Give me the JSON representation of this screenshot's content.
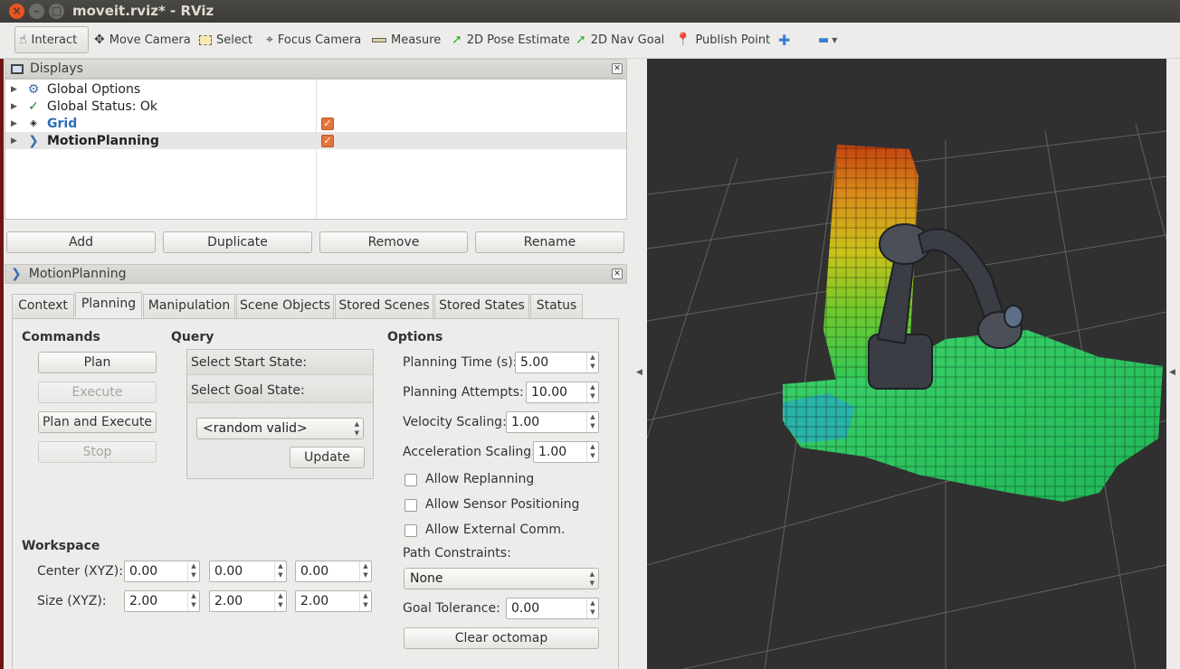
{
  "window": {
    "title": "moveit.rviz* - RViz"
  },
  "toolbar": {
    "items": [
      {
        "label": "Interact",
        "icon": "hand-icon"
      },
      {
        "label": "Move Camera",
        "icon": "move-camera-icon"
      },
      {
        "label": "Select",
        "icon": "select-icon"
      },
      {
        "label": "Focus Camera",
        "icon": "focus-camera-icon"
      },
      {
        "label": "Measure",
        "icon": "ruler-icon"
      },
      {
        "label": "2D Pose Estimate",
        "icon": "green-arrow-icon"
      },
      {
        "label": "2D Nav Goal",
        "icon": "green-arrow-icon"
      },
      {
        "label": "Publish Point",
        "icon": "map-pin-icon"
      }
    ],
    "add_icon": "plus-icon",
    "remove_icon": "minus-icon"
  },
  "displays": {
    "header": "Displays",
    "items": [
      {
        "label": "Global Options",
        "icon": "gear-icon"
      },
      {
        "label": "Global Status: Ok",
        "icon": "checkmark-icon"
      },
      {
        "label": "Grid",
        "icon": "grid-icon",
        "checked": true
      },
      {
        "label": "MotionPlanning",
        "icon": "motion-planning-icon",
        "checked": true
      }
    ],
    "buttons": {
      "add": "Add",
      "duplicate": "Duplicate",
      "remove": "Remove",
      "rename": "Rename"
    }
  },
  "motion_planning": {
    "header": "MotionPlanning",
    "tabs": [
      "Context",
      "Planning",
      "Manipulation",
      "Scene Objects",
      "Stored Scenes",
      "Stored States",
      "Status"
    ],
    "active_tab": "Planning",
    "commands": {
      "title": "Commands",
      "plan": "Plan",
      "execute": "Execute",
      "plan_and_execute": "Plan and Execute",
      "stop": "Stop"
    },
    "query": {
      "title": "Query",
      "start_state": "Select Start State:",
      "goal_state": "Select Goal State:",
      "goal_value": "<random valid>",
      "update": "Update"
    },
    "options": {
      "title": "Options",
      "planning_time_label": "Planning Time (s):",
      "planning_time": "5.00",
      "planning_attempts_label": "Planning Attempts:",
      "planning_attempts": "10.00",
      "velocity_scaling_label": "Velocity Scaling:",
      "velocity_scaling": "1.00",
      "acceleration_scaling_label": "Acceleration Scaling:",
      "acceleration_scaling": "1.00",
      "allow_replanning": "Allow Replanning",
      "allow_sensor_positioning": "Allow Sensor Positioning",
      "allow_external_comm": "Allow External Comm.",
      "path_constraints_label": "Path Constraints:",
      "path_constraints": "None",
      "goal_tolerance_label": "Goal Tolerance:",
      "goal_tolerance": "0.00",
      "clear_octomap": "Clear octomap"
    },
    "workspace": {
      "title": "Workspace",
      "center_label": "Center (XYZ):",
      "center": [
        "0.00",
        "0.00",
        "0.00"
      ],
      "size_label": "Size (XYZ):",
      "size": [
        "2.00",
        "2.00",
        "2.00"
      ]
    }
  },
  "colors": {
    "accent": "#e5753a",
    "viewport_bg": "#303030",
    "titlebar": "#3c3b37"
  }
}
